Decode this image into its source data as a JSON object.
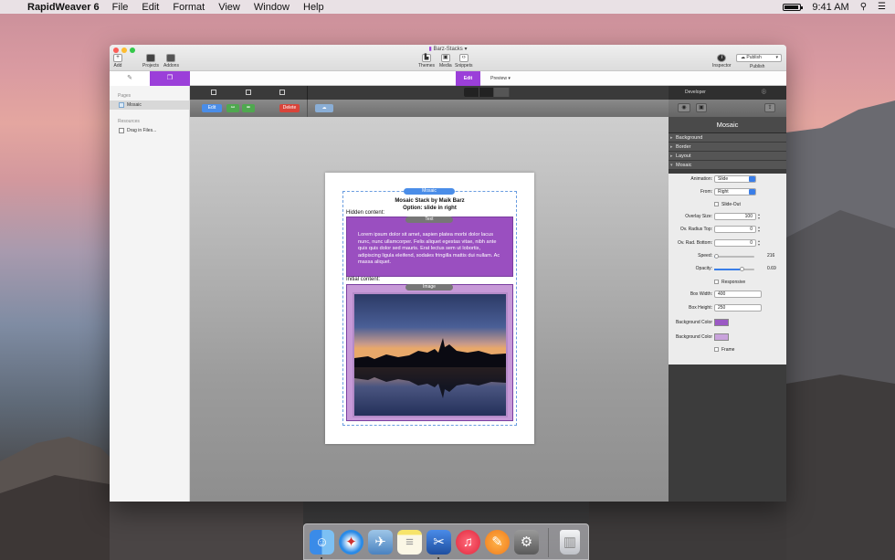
{
  "menubar": {
    "app_name": "RapidWeaver 6",
    "menus": [
      "File",
      "Edit",
      "Format",
      "View",
      "Window",
      "Help"
    ],
    "clock": "9:41 AM"
  },
  "window": {
    "title": "Barz-Stacks",
    "toolbar": {
      "add": "Add",
      "projects": "Projects",
      "addons": "Addons",
      "themes": "Themes",
      "media": "Media",
      "snippets": "Snippets",
      "inspector": "Inspector",
      "publish": "Publish",
      "publish_button": "Publish"
    },
    "tabs": {
      "edit": "Edit",
      "preview": "Preview"
    }
  },
  "sidebar": {
    "pages_heading": "Pages",
    "pages": [
      {
        "label": "Mosaic"
      }
    ],
    "resources_heading": "Resources",
    "resources": [
      {
        "label": "Drag in Files..."
      }
    ]
  },
  "editor": {
    "buttons": {
      "edit": "Edit",
      "delete": "Delete"
    },
    "stack": {
      "badge": "Mosaic",
      "title_line1": "Mosaic Stack by Maik Barz",
      "title_line2": "Option: slide in right",
      "hidden_label": "Hidden content:",
      "text_badge": "Text",
      "lorem": "Lorem ipsum dolor sit amet, sapien platea morbi dolor lacus nunc, nunc ullamcorper. Felis aliquet egestas vitae, nibh ante quis quis dolor sed mauris. Erat lectus sem ut lobortis, adipiscing ligula eleifend, sodales fringilla mattis dui nullam. Ac massa aliquet.",
      "initial_label": "Initial content:",
      "image_badge": "Image"
    }
  },
  "inspector": {
    "top_label": "Developer",
    "title": "Mosaic",
    "sections": [
      "Background",
      "Border",
      "Layout",
      "Mosaic"
    ],
    "fields": {
      "animation": {
        "label": "Animation:",
        "value": "Slide"
      },
      "from": {
        "label": "From:",
        "value": "Right"
      },
      "slide_out": {
        "label": "Slide-Out"
      },
      "overlay_size": {
        "label": "Overlay Size:",
        "value": "100"
      },
      "ov_radius_top": {
        "label": "Ov. Radius Top:",
        "value": "0"
      },
      "ov_rad_bottom": {
        "label": "Ov. Rad. Bottom:",
        "value": "0"
      },
      "speed": {
        "label": "Speed:",
        "value": "216",
        "fraction": 0.05
      },
      "opacity": {
        "label": "Opacity:",
        "value": "0.69",
        "fraction": 0.69
      },
      "responsive": {
        "label": "Responsive"
      },
      "box_width": {
        "label": "Box Width:",
        "value": "400"
      },
      "box_height": {
        "label": "Box Height:",
        "value": "250"
      },
      "bg_color1": {
        "label": "Background Color",
        "color": "#9b59c4"
      },
      "bg_color2": {
        "label": "Background Color",
        "color": "#c9a3dc"
      },
      "frame": {
        "label": "Frame"
      }
    }
  },
  "dock": {
    "apps": [
      "finder-icon",
      "safari-icon",
      "mail-icon",
      "notes-icon",
      "rapidweaver-icon",
      "itunes-icon",
      "ibooks-icon",
      "system-preferences-icon",
      "trash-icon"
    ]
  },
  "colors": {
    "accent": "#9b3fd9",
    "stack_blue": "#4a8de8",
    "text_box": "#9a4fc0",
    "image_frame": "#c799d8",
    "delete_red": "#d9443a"
  }
}
